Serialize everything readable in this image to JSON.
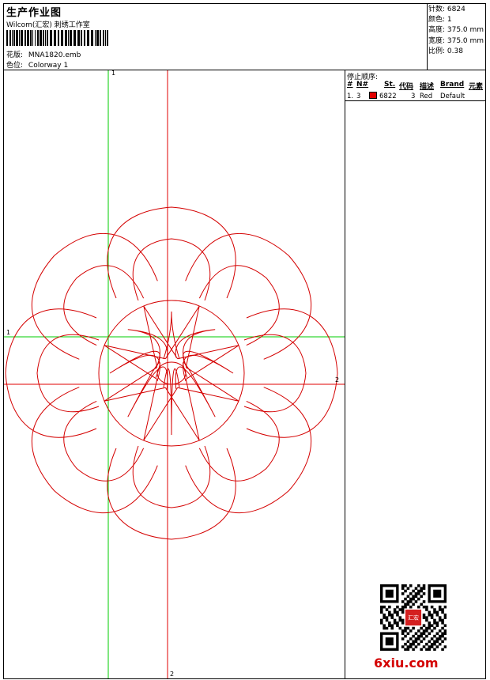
{
  "header": {
    "title": "生产作业图",
    "company": "Wilcom(汇宏) 刺绣工作室",
    "design_label": "花版:",
    "design_value": "MNA1820.emb",
    "colorway_label": "色位:",
    "colorway_value": "Colorway 1"
  },
  "stats": {
    "stitches": "针数: 6824",
    "colors": "颜色: 1",
    "height": "高度: 375.0 mm",
    "width": "宽度: 375.0 mm",
    "scale": "比例: 0.38"
  },
  "stop_sequence": {
    "title": "停止顺序:",
    "headers": [
      "#",
      "N#",
      "St.",
      "代码",
      "描述",
      "Brand",
      "元素"
    ],
    "rows": [
      {
        "index": "1.",
        "needle": "3",
        "stitches": "6822",
        "code": "3",
        "description": "Red",
        "brand": "Default",
        "color": "#e00000"
      }
    ]
  },
  "guides": {
    "v1_top": "1",
    "h1_left": "1",
    "h2_right": "2",
    "v2_bottom": "2"
  },
  "colors": {
    "thread": "#d40000",
    "guide_green": "#00cc00",
    "guide_red": "#e00000"
  },
  "watermark": "6xiu.com",
  "seal_text": "汇宏"
}
